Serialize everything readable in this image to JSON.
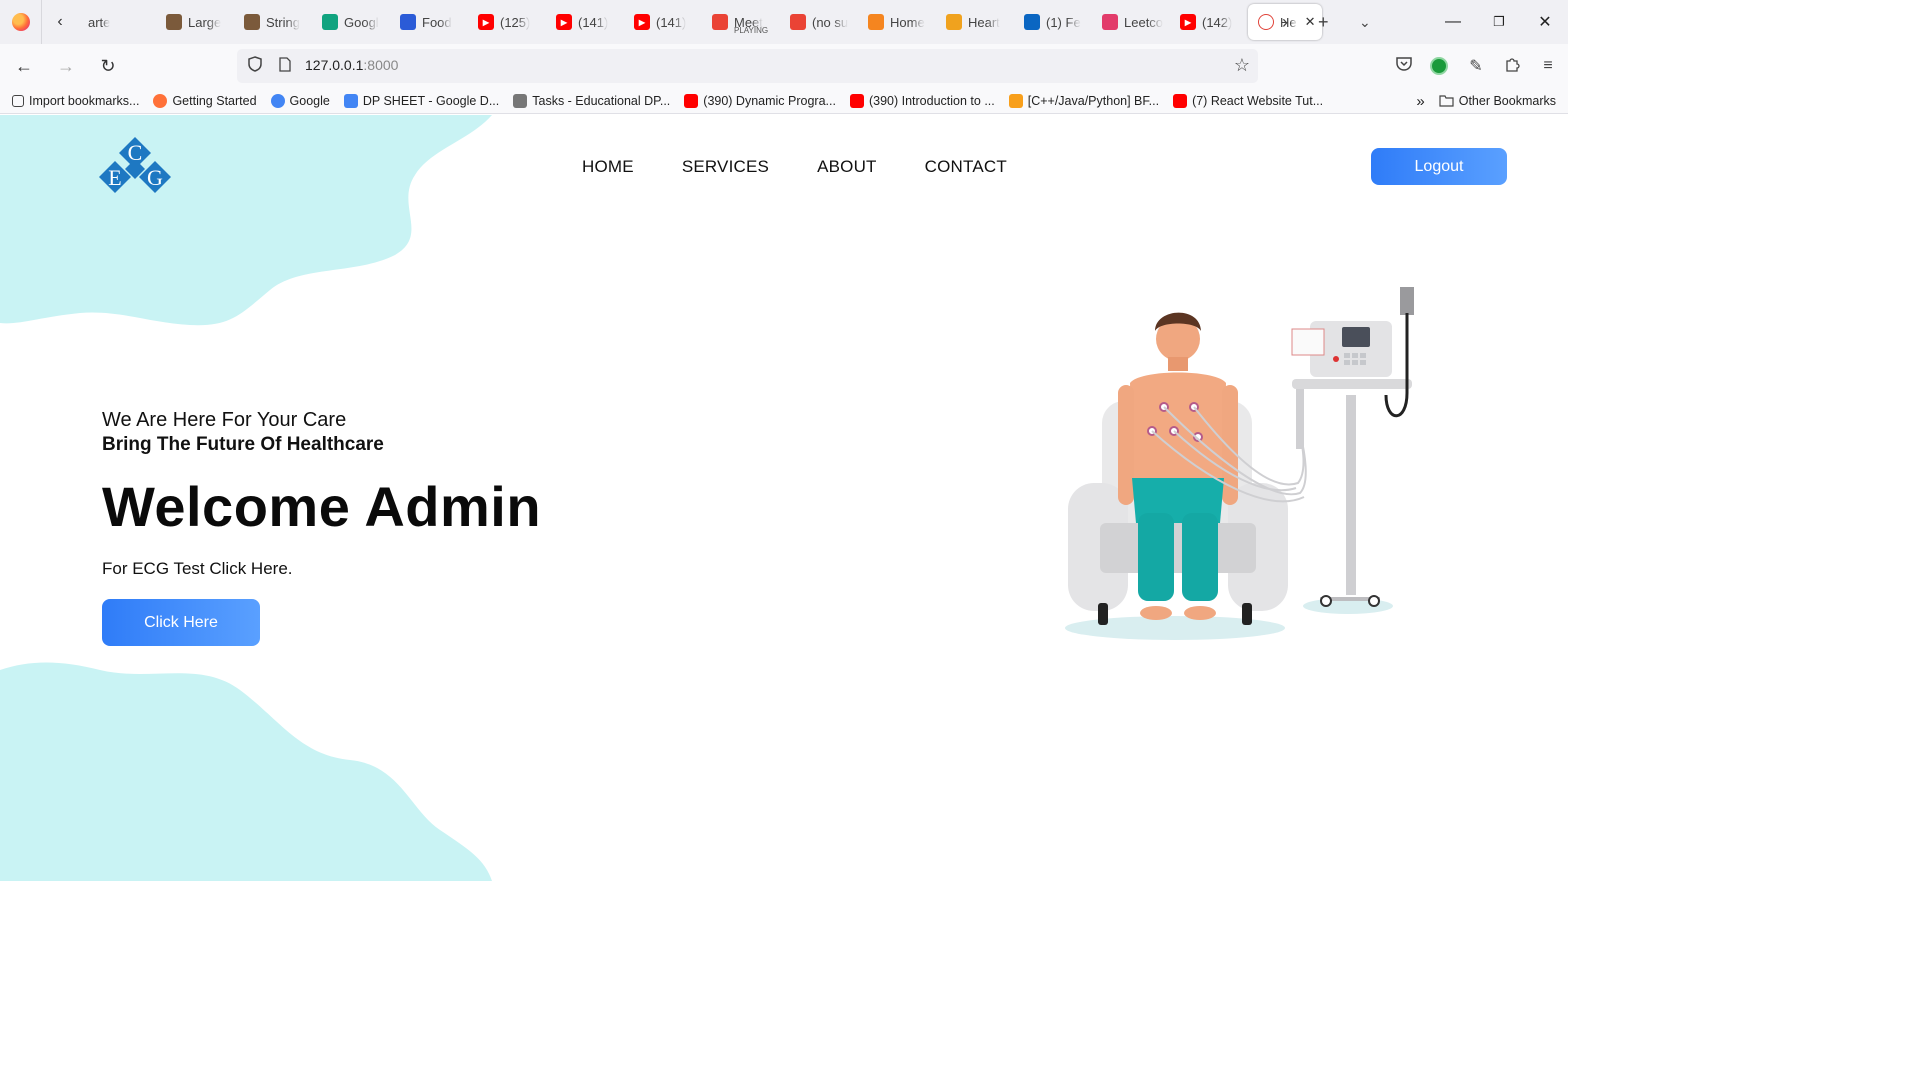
{
  "browser": {
    "tabs": [
      {
        "label": "arte",
        "icon": "chevron-left-icon"
      },
      {
        "label": "Large",
        "icon": "cc-icon"
      },
      {
        "label": "String",
        "icon": "cc-icon"
      },
      {
        "label": "Googl",
        "icon": "chatgpt-icon"
      },
      {
        "label": "Food",
        "icon": "quill-icon"
      },
      {
        "label": "(125)",
        "icon": "youtube-icon"
      },
      {
        "label": "(141)",
        "icon": "youtube-icon"
      },
      {
        "label": "(141)",
        "icon": "youtube-icon"
      },
      {
        "label": "Meet",
        "sub": "PLAYING",
        "icon": "meet-icon"
      },
      {
        "label": "(no su",
        "icon": "gmail-icon"
      },
      {
        "label": "Home",
        "icon": "loader-icon"
      },
      {
        "label": "Heart",
        "icon": "book-icon"
      },
      {
        "label": "(1) Fe",
        "icon": "linkedin-icon"
      },
      {
        "label": "Leetco",
        "icon": "rainbow-icon"
      },
      {
        "label": "(142)",
        "icon": "youtube-icon"
      },
      {
        "label": "He",
        "icon": "heart-icon",
        "active": true
      }
    ],
    "url_host": "127.0.0.1",
    "url_port": ":8000",
    "bookmarks": [
      {
        "label": "Import bookmarks...",
        "icon": "import-icon"
      },
      {
        "label": "Getting Started",
        "icon": "firefox-icon"
      },
      {
        "label": "Google",
        "icon": "google-icon"
      },
      {
        "label": "DP SHEET - Google D...",
        "icon": "docs-icon"
      },
      {
        "label": "Tasks - Educational DP...",
        "icon": "tasks-icon"
      },
      {
        "label": "(390) Dynamic Progra...",
        "icon": "youtube-icon"
      },
      {
        "label": "(390) Introduction to ...",
        "icon": "youtube-icon"
      },
      {
        "label": "[C++/Java/Python] BF...",
        "icon": "leetcode-icon"
      },
      {
        "label": "(7) React Website Tut...",
        "icon": "youtube-icon"
      }
    ],
    "other_bookmarks": "Other Bookmarks"
  },
  "page": {
    "logo_letters": {
      "top": "C",
      "left": "E",
      "right": "G"
    },
    "nav": [
      "HOME",
      "SERVICES",
      "ABOUT",
      "CONTACT"
    ],
    "logout_label": "Logout",
    "tagline": "We Are Here For Your Care",
    "subline": "Bring The Future Of Healthcare",
    "welcome": "Welcome Admin",
    "cta_text": "For ECG Test Click Here.",
    "cta_button": "Click Here",
    "colors": {
      "accent": "#2f7cf8",
      "blob": "#c9f3f4",
      "logo": "#1e78c2"
    }
  }
}
